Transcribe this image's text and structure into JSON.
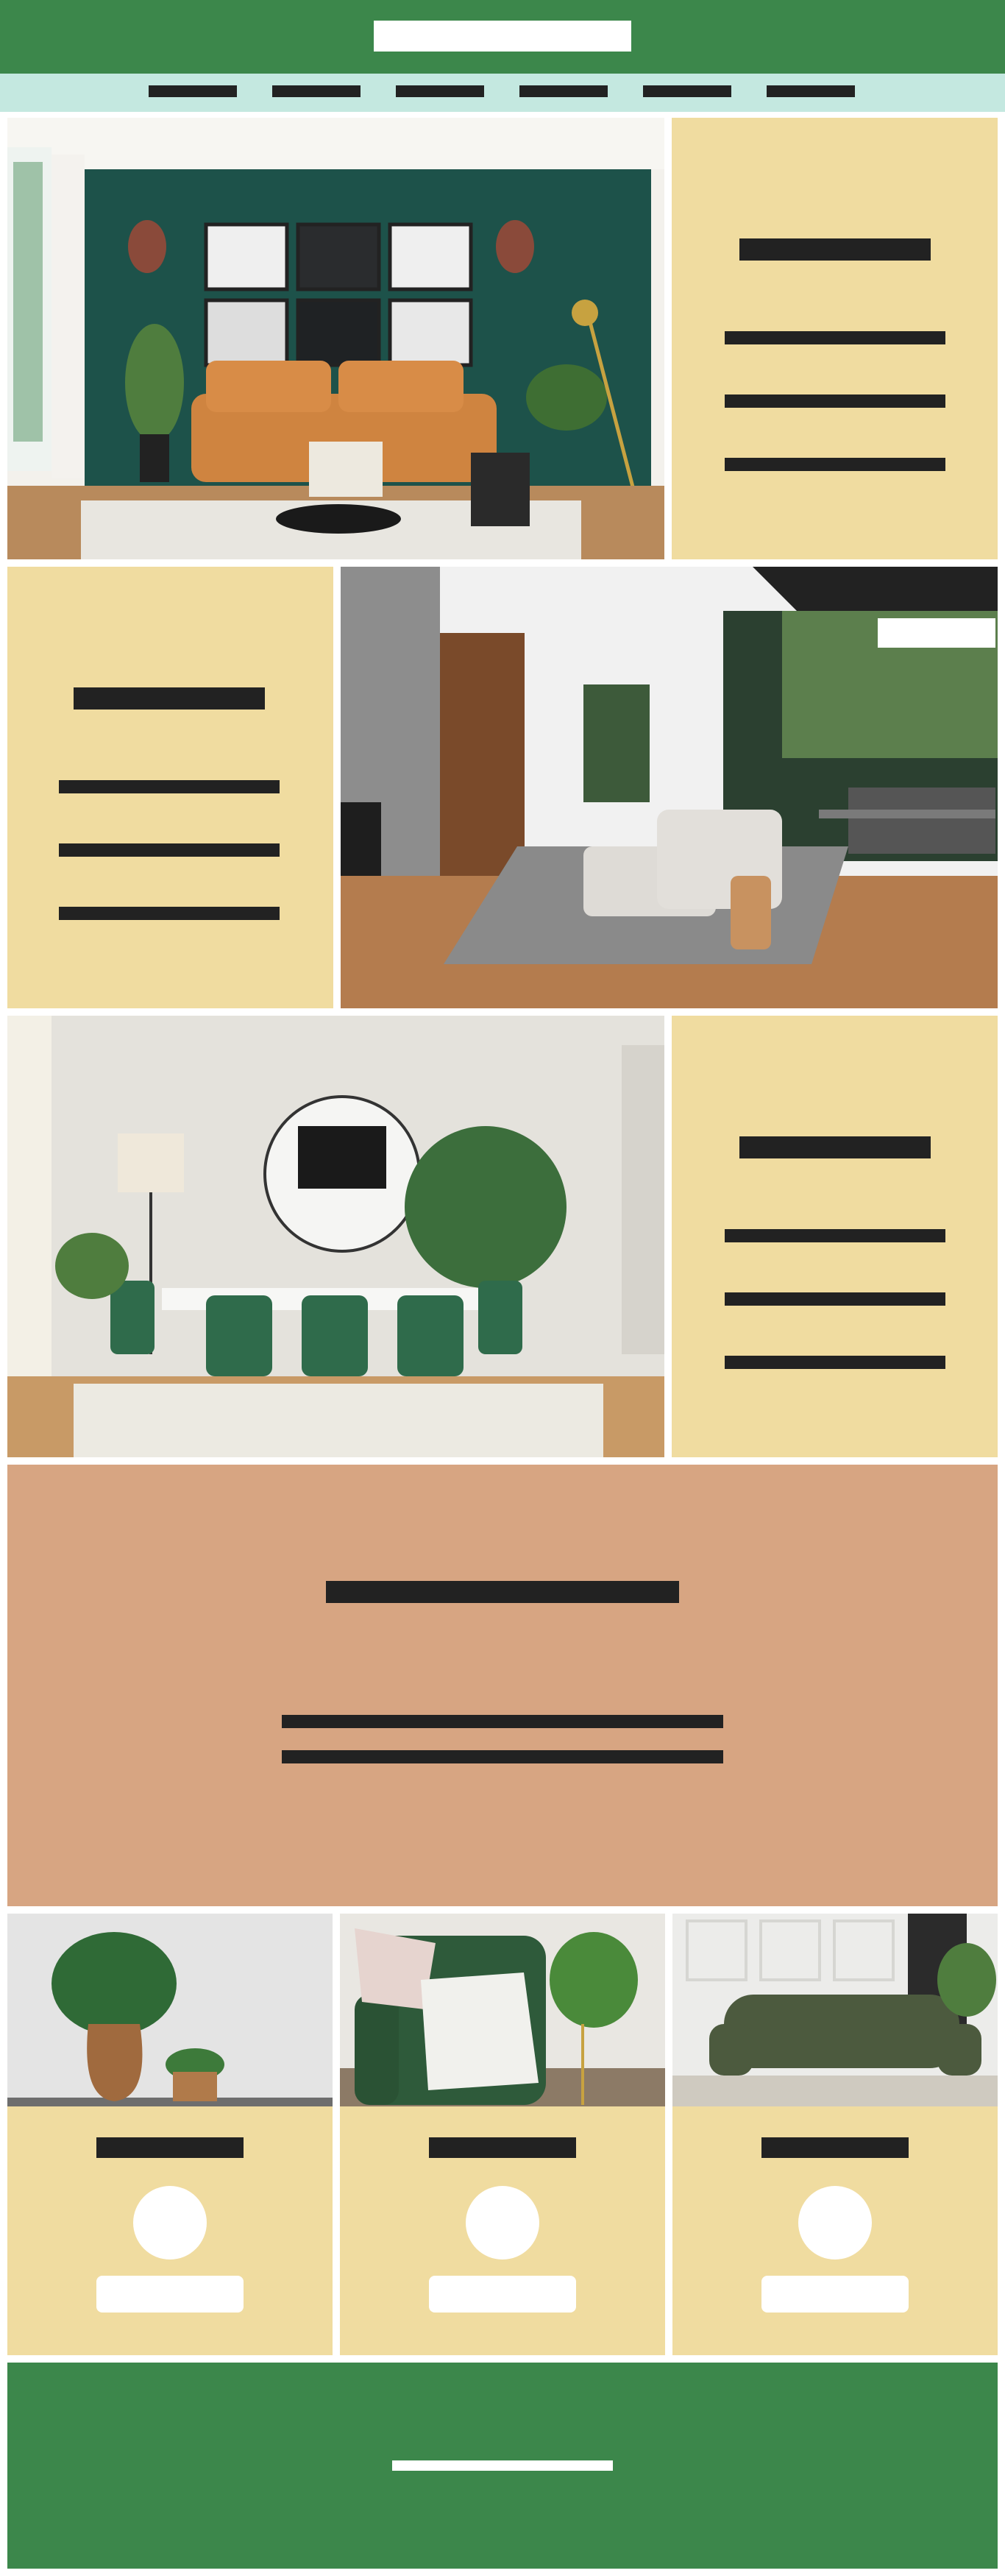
{
  "header": {
    "logo": "",
    "logo_icon": "logo-placeholder"
  },
  "nav": {
    "items": [
      "",
      "",
      "",
      "",
      "",
      ""
    ]
  },
  "sections": [
    {
      "image": "living-room-green-wall-photo",
      "heading": "",
      "lines": [
        "",
        "",
        ""
      ]
    },
    {
      "image": "open-living-room-patio-photo",
      "heading": "",
      "lines": [
        "",
        "",
        ""
      ]
    },
    {
      "image": "dining-room-green-chairs-photo",
      "heading": "",
      "lines": [
        "",
        "",
        ""
      ]
    }
  ],
  "banner": {
    "heading": "",
    "lines": [
      "",
      ""
    ]
  },
  "cards": [
    {
      "image": "potted-plant-photo",
      "title": "",
      "avatar_icon": "avatar",
      "button": ""
    },
    {
      "image": "green-armchair-photo",
      "title": "",
      "avatar_icon": "avatar",
      "button": ""
    },
    {
      "image": "green-sofa-photo",
      "title": "",
      "avatar_icon": "avatar",
      "button": ""
    }
  ],
  "footer": {
    "text": ""
  },
  "colors": {
    "primary": "#3c874b",
    "nav": "#c4e8e0",
    "cream": "#f0dca0",
    "banner": "#d7a582",
    "text_bar": "#222222"
  }
}
